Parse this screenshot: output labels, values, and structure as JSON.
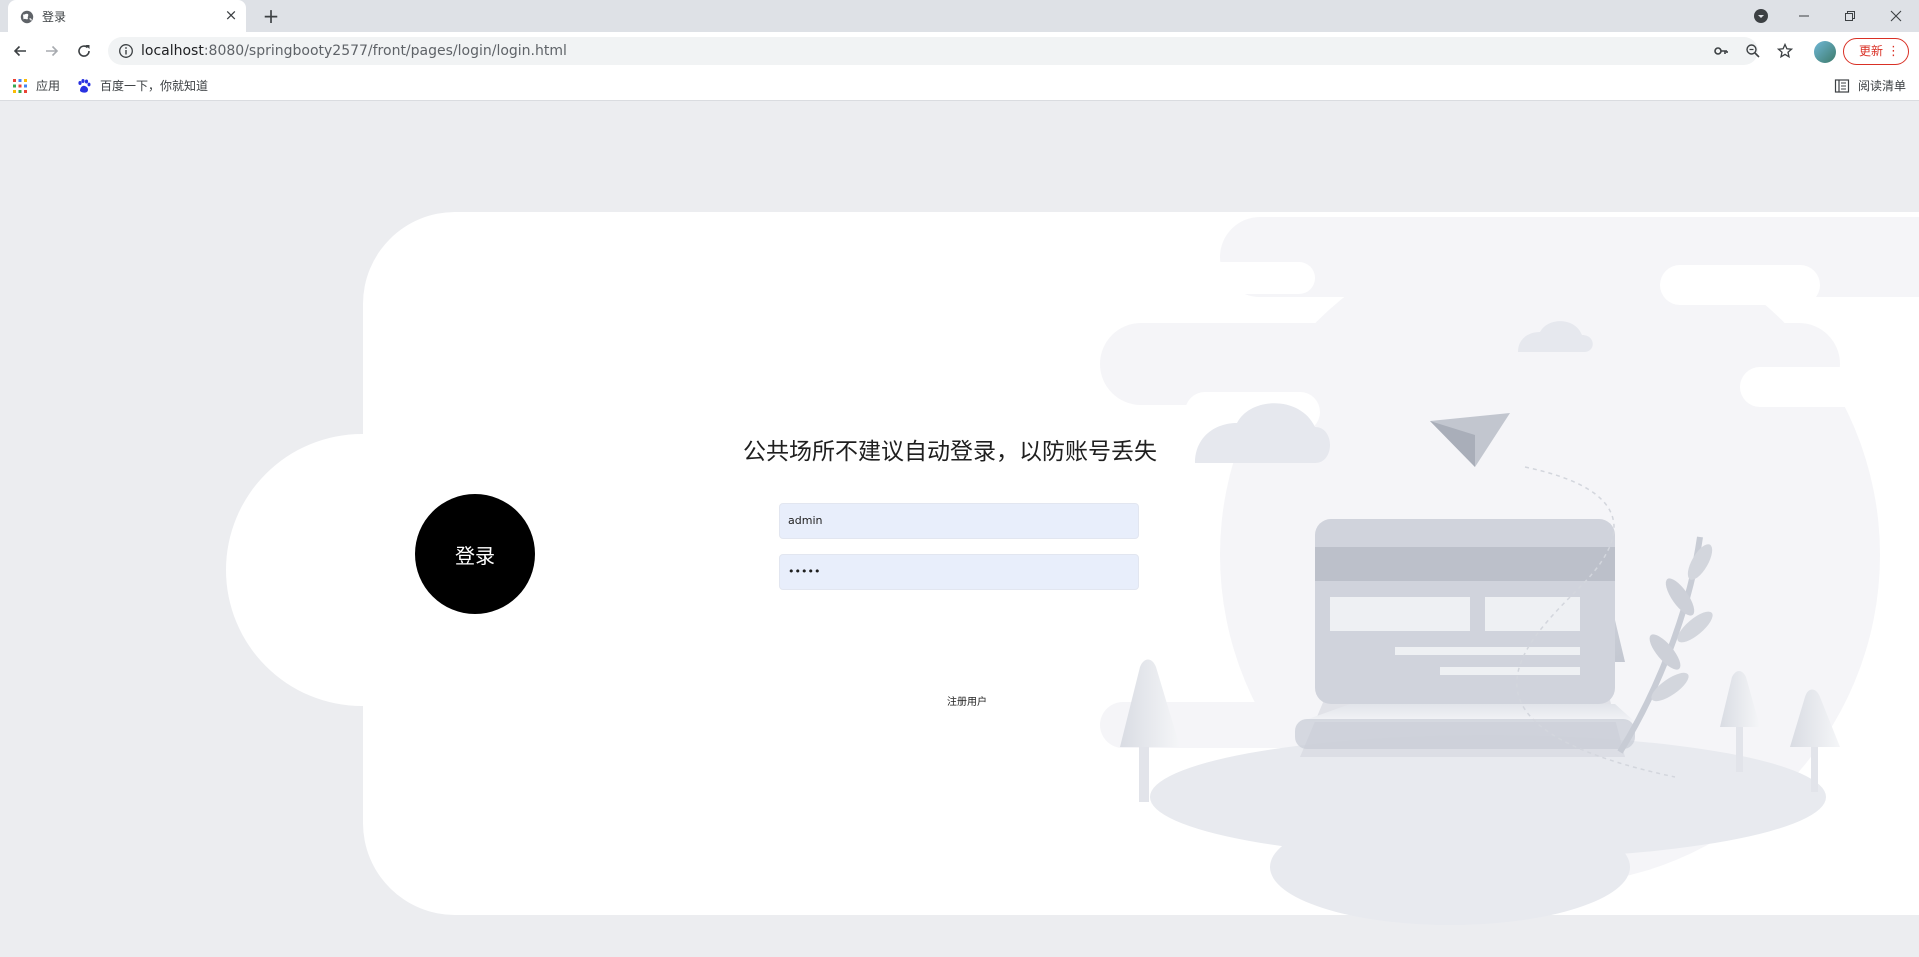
{
  "browser": {
    "tab_title": "登录",
    "tab_close": "×",
    "new_tab": "+",
    "url_host": "localhost",
    "url_path": ":8080/springbooty2577/front/pages/login/login.html",
    "update_label": "更新",
    "update_menu": "⋮",
    "bookmarks": [
      {
        "label": "应用",
        "icon": "apps-grid-icon"
      },
      {
        "label": "百度一下，你就知道",
        "icon": "baidu-paw-icon"
      }
    ],
    "reading_list_label": "阅读清单"
  },
  "login": {
    "circle_label": "登录",
    "notice": "公共场所不建议自动登录，以防账号丢失",
    "username_value": "admin",
    "password_value": "•••••",
    "register_link": "注册用户"
  },
  "colors": {
    "page_bg": "#ecedf0",
    "card_bg": "#ffffff",
    "input_bg": "#e8eefb",
    "circle_bg": "#000000",
    "update_red": "#d93025"
  }
}
